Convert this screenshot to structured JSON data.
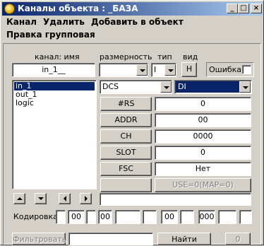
{
  "window": {
    "title": "Каналы объекта : _БАЗА",
    "minimize": "_",
    "maximize": "□",
    "close": "×"
  },
  "menu": {
    "row1": [
      "Канал",
      "Удалить",
      "Добавить в объект"
    ],
    "row2": [
      "Правка групповая"
    ]
  },
  "headers": {
    "name": "канал: имя",
    "dimension": "размерность",
    "type": "тип",
    "view": "вид"
  },
  "inputs": {
    "name_value": "in_1__",
    "dimension_value": "",
    "type_value": "I",
    "view_button": "H",
    "error_label": "Ошибка"
  },
  "channels": [
    "in_1",
    "out_1",
    "logic"
  ],
  "selected_channel": "in_1",
  "dcs": {
    "left_select": "DCS",
    "right_select": "DI"
  },
  "params": [
    {
      "label": "#RS",
      "value": "0"
    },
    {
      "label": "ADDR",
      "value": "00"
    },
    {
      "label": "CH",
      "value": "0000"
    },
    {
      "label": "SLOT",
      "value": "0"
    },
    {
      "label": "FSC",
      "value": "Нет"
    }
  ],
  "use_field": "USE=0(MAP=0)",
  "encoding": {
    "label": "Кодировка",
    "values": [
      "",
      "00",
      "",
      "00",
      "",
      "",
      "00",
      "",
      "000",
      ""
    ]
  },
  "bottom": {
    "filter_button": "Фильтровать",
    "filter_value": "",
    "find_button": "Найти",
    "counter": "0"
  }
}
